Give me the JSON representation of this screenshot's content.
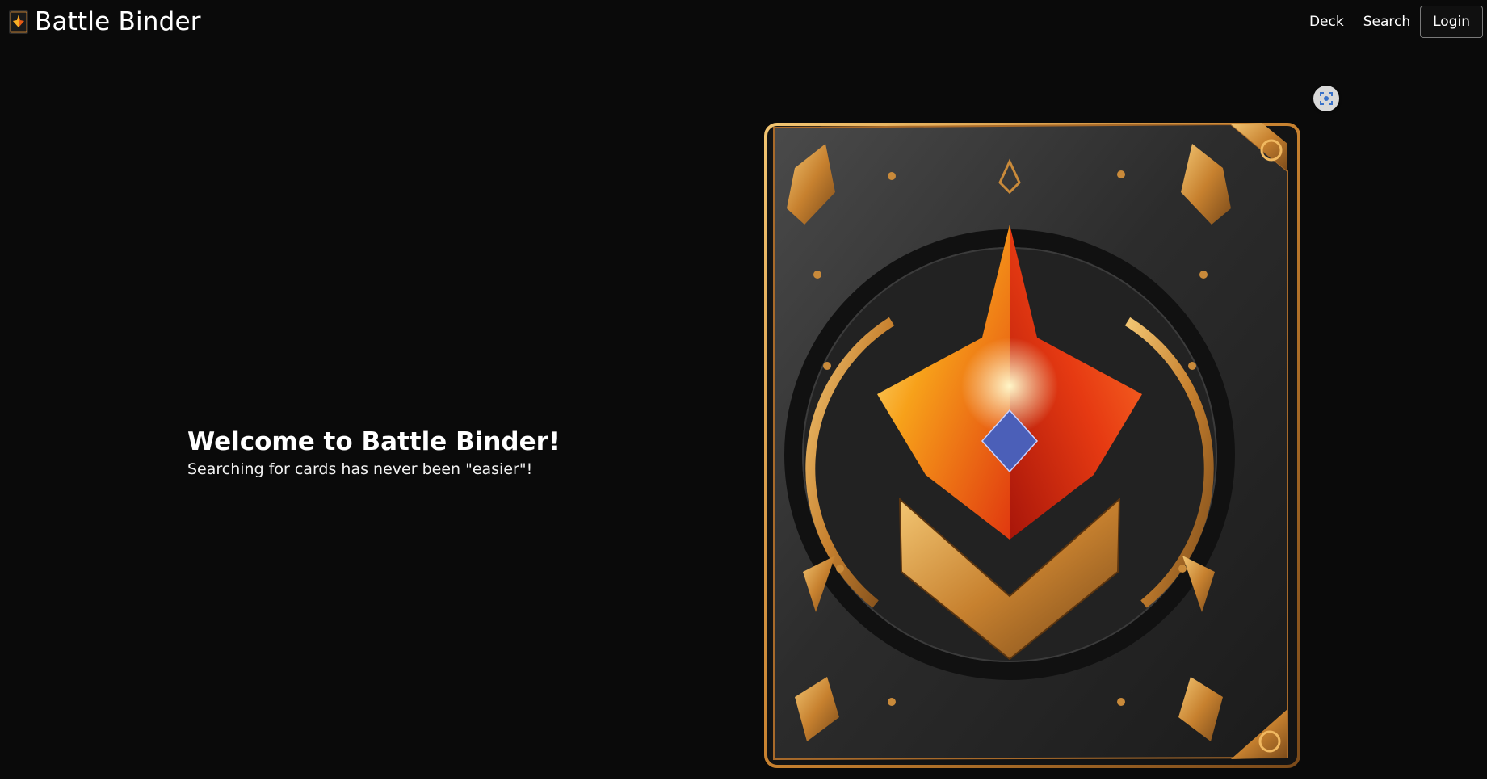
{
  "navbar": {
    "brand_text": "Battle Binder",
    "logo_icon": "battle-binder-logo-icon",
    "links": {
      "deck_label": "Deck",
      "search_label": "Search",
      "login_label": "Login"
    }
  },
  "hero": {
    "title": "Welcome to Battle Binder!",
    "subtitle": "Searching for cards has never been \"easier\"!"
  },
  "image": {
    "subject": "binder-cover-art",
    "overlay_icon": "visual-search-lens-icon"
  },
  "colors": {
    "background": "#0a0a0a",
    "text": "#ffffff",
    "gold": "#c98a3a",
    "flame": "#f05a14"
  }
}
